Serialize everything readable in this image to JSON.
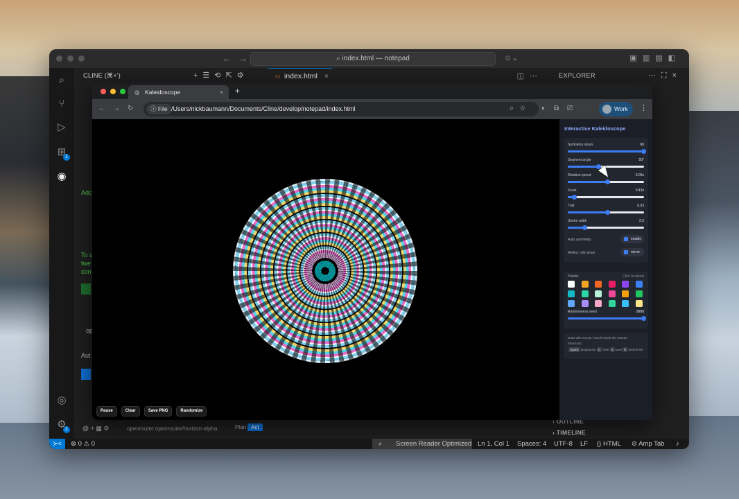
{
  "editor": {
    "title": "index.html — notepad",
    "cline_panel_title": "CLINE (⌘+')",
    "tab_label": "index.html",
    "explorer_title": "EXPLORER",
    "outline_label": "OUTLINE",
    "timeline_label": "TIMELINE",
    "model_label": "openrouter:openrouter/horizon-alpha",
    "plan_label": "Plan",
    "act_label": "Act",
    "left_fragments": [
      "Adc",
      "To u",
      "twe",
      "con",
      "Aut",
      "op"
    ],
    "status": {
      "problems": "⊗ 0 ⚠ 0",
      "screen_reader": "Screen Reader Optimized",
      "position": "Ln 1, Col 1",
      "spaces": "Spaces: 4",
      "encoding": "UTF-8",
      "eol": "LF",
      "language": "{} HTML",
      "amp": "Amp Tab"
    },
    "badges": {
      "extensions": "1",
      "settings": "1"
    }
  },
  "browser": {
    "tab_title": "Kaleidoscope",
    "file_chip": "File",
    "url": "/Users/nickbaumann/Documents/Cline/develop/notepad/index.html",
    "profile": "Work"
  },
  "app": {
    "title": "Interactive Kaleidoscope",
    "sliders": [
      {
        "label": "Symmetry slices",
        "value_text": "60",
        "fraction": 0.99
      },
      {
        "label": "Segment angle",
        "value_text": "50°",
        "fraction": 0.4
      },
      {
        "label": "Rotation speed",
        "value_text": "0.06x",
        "fraction": 0.52
      },
      {
        "label": "Scale",
        "value_text": "0.43x",
        "fraction": 0.08
      },
      {
        "label": "Trail",
        "value_text": "0.53",
        "fraction": 0.52
      },
      {
        "label": "Stroke width",
        "value_text": "2.5",
        "fraction": 0.22
      }
    ],
    "toggles": [
      {
        "label": "Auto symmetry",
        "pill": "enable"
      },
      {
        "label": "Reflect odd slices",
        "pill": "mirror"
      }
    ],
    "palette_label": "Palette",
    "palette_hint": "Click to select",
    "palette_colors": [
      "#ffffff",
      "#f5a623",
      "#f26522",
      "#e91e63",
      "#8e44ef",
      "#3b82f6",
      "#14b8c8",
      "#2dd4a7",
      "#b8f0d8",
      "#ec4899",
      "#f59e0b",
      "#22c55e",
      "#60a5fa",
      "#a78bfa",
      "#f9a8c4",
      "#34d399",
      "#38bdf8",
      "#fde68a"
    ],
    "random_seed": {
      "label": "Randomness seed",
      "value_text": "9999",
      "fraction": 0.99
    },
    "hint_line1": "Draw with mouse / touch inside the canvas.",
    "shortcuts_label": "Shortcuts:",
    "shortcuts": [
      {
        "key": "Space",
        "desc": "play/pause"
      },
      {
        "key": "C",
        "desc": "clear"
      },
      {
        "key": "S",
        "desc": "save"
      },
      {
        "key": "R",
        "desc": "randomize"
      }
    ],
    "buttons": [
      "Pause",
      "Clear",
      "Save PNG",
      "Randomize"
    ]
  }
}
